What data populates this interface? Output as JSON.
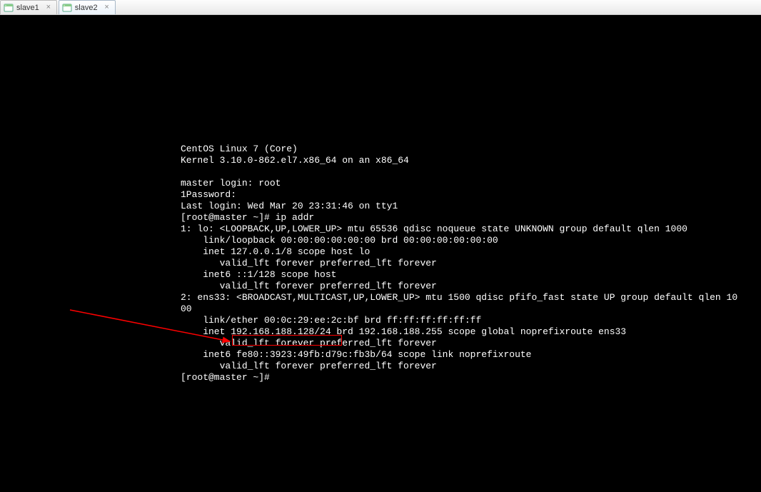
{
  "tabs": [
    {
      "label": "slave1"
    },
    {
      "label": "slave2"
    }
  ],
  "terminal": {
    "lines": [
      "CentOS Linux 7 (Core)",
      "Kernel 3.10.0-862.el7.x86_64 on an x86_64",
      "",
      "master login: root",
      "1Password:",
      "Last login: Wed Mar 20 23:31:46 on tty1",
      "[root@master ~]# ip addr",
      "1: lo: <LOOPBACK,UP,LOWER_UP> mtu 65536 qdisc noqueue state UNKNOWN group default qlen 1000",
      "    link/loopback 00:00:00:00:00:00 brd 00:00:00:00:00:00",
      "    inet 127.0.0.1/8 scope host lo",
      "       valid_lft forever preferred_lft forever",
      "    inet6 ::1/128 scope host",
      "       valid_lft forever preferred_lft forever",
      "2: ens33: <BROADCAST,MULTICAST,UP,LOWER_UP> mtu 1500 qdisc pfifo_fast state UP group default qlen 10",
      "00",
      "    link/ether 00:0c:29:ee:2c:bf brd ff:ff:ff:ff:ff:ff",
      "    inet 192.168.188.128/24 brd 192.168.188.255 scope global noprefixroute ens33",
      "       valid_lft forever preferred_lft forever",
      "    inet6 fe80::3923:49fb:d79c:fb3b/64 scope link noprefixroute",
      "       valid_lft forever preferred_lft forever",
      "[root@master ~]#"
    ]
  },
  "annotation": {
    "highlighted_ip": "192.168.188.128/24"
  }
}
